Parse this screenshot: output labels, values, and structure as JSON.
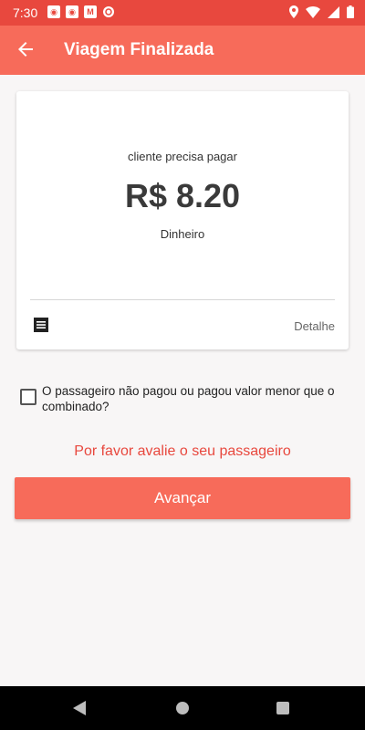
{
  "status_bar": {
    "time": "7:30",
    "icons": [
      "notification-app-icon",
      "notification-app-icon",
      "gmail-icon",
      "sync-icon",
      "location-icon",
      "wifi-icon",
      "signal-icon",
      "battery-icon"
    ]
  },
  "app_bar": {
    "title": "Viagem Finalizada",
    "background": "#f76b5a"
  },
  "payment_card": {
    "caption": "cliente precisa pagar",
    "amount": "R$ 8.20",
    "method": "Dinheiro",
    "detail_label": "Detalhe"
  },
  "underpaid_checkbox": {
    "label": "O passageiro não pagou ou pagou valor menor que o combinado?",
    "checked": false
  },
  "rate_passenger_text": "Por favor avalie o seu passageiro",
  "advance_button_label": "Avançar",
  "colors": {
    "accent": "#f76b5a",
    "status_bar": "#e8483e",
    "link_red": "#e8483e"
  }
}
